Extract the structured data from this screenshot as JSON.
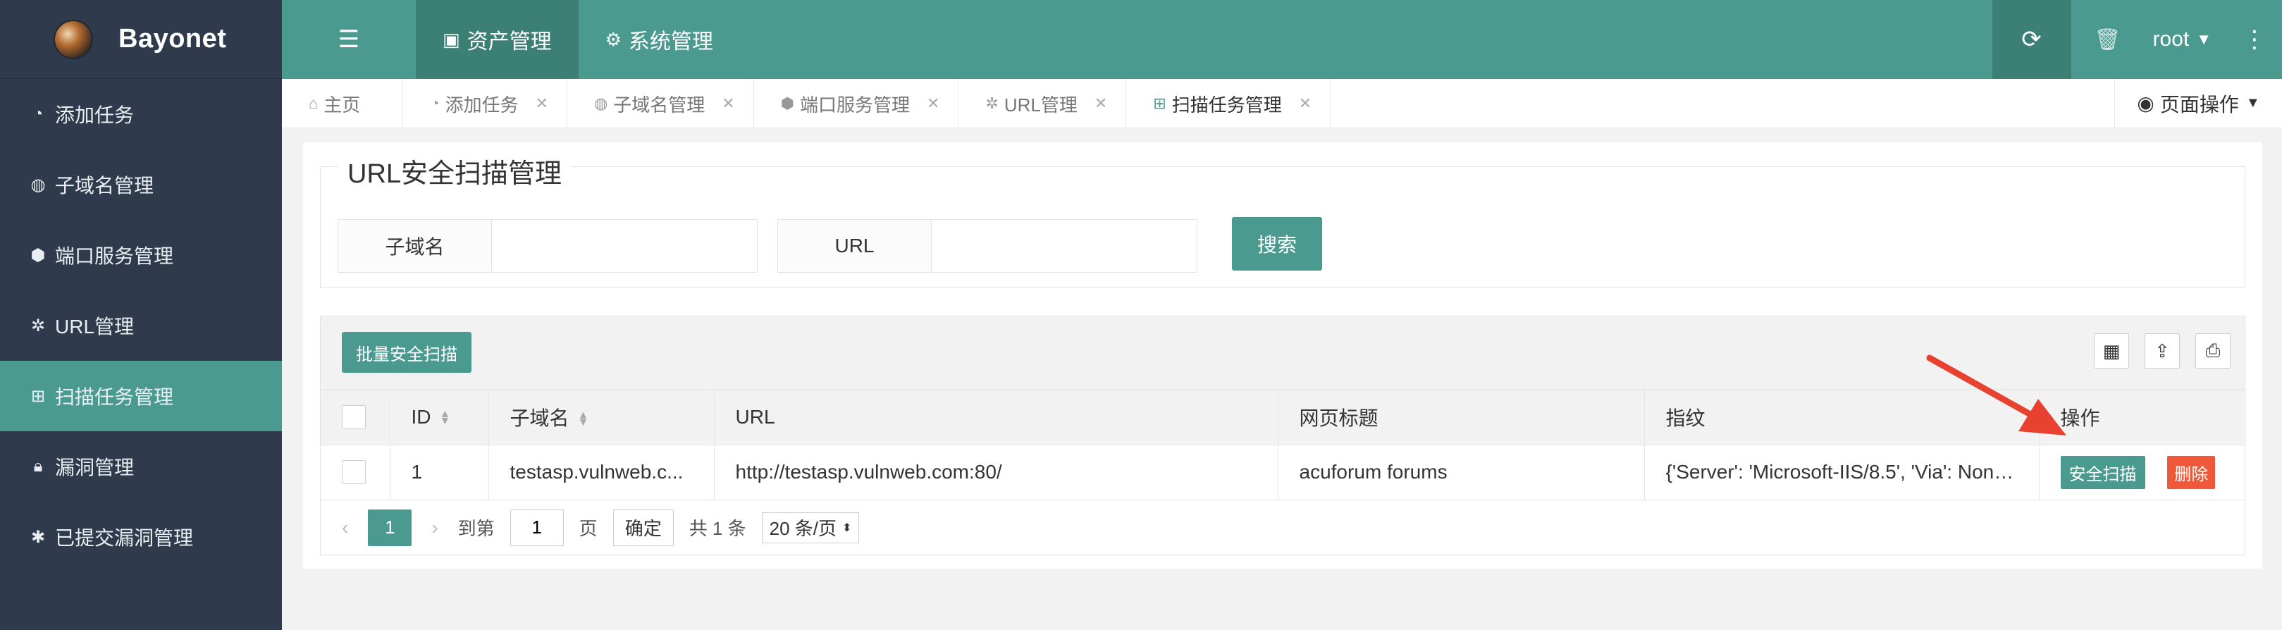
{
  "app": {
    "name": "Bayonet"
  },
  "sidebar": {
    "items": [
      {
        "label": "添加任务",
        "icon": "dashboard-icon"
      },
      {
        "label": "子域名管理",
        "icon": "globe-icon"
      },
      {
        "label": "端口服务管理",
        "icon": "cube-icon"
      },
      {
        "label": "URL管理",
        "icon": "paw-icon"
      },
      {
        "label": "扫描任务管理",
        "icon": "plus-square-icon",
        "active": true
      },
      {
        "label": "漏洞管理",
        "icon": "lock-icon"
      },
      {
        "label": "已提交漏洞管理",
        "icon": "bug-icon"
      }
    ]
  },
  "topbar": {
    "tabs": [
      {
        "label": "资产管理",
        "icon": "address-book-icon",
        "active": true
      },
      {
        "label": "系统管理",
        "icon": "cogs-icon"
      }
    ],
    "user": "root"
  },
  "page_tabs": [
    {
      "label": "主页",
      "icon": "home-icon",
      "closable": false
    },
    {
      "label": "添加任务",
      "icon": "dashboard-icon",
      "closable": true
    },
    {
      "label": "子域名管理",
      "icon": "globe-icon",
      "closable": true
    },
    {
      "label": "端口服务管理",
      "icon": "cube-icon",
      "closable": true
    },
    {
      "label": "URL管理",
      "icon": "paw-icon",
      "closable": true
    },
    {
      "label": "扫描任务管理",
      "icon": "plus-square-icon",
      "closable": true,
      "active": true
    }
  ],
  "page_ops_label": "页面操作",
  "search": {
    "legend": "URL安全扫描管理",
    "subdomain_label": "子域名",
    "subdomain_value": "",
    "url_label": "URL",
    "url_value": "",
    "button": "搜索"
  },
  "table": {
    "batch_button": "批量安全扫描",
    "columns": [
      "ID",
      "子域名",
      "URL",
      "网页标题",
      "指纹",
      "操作"
    ],
    "rows": [
      {
        "id": "1",
        "subdomain": "testasp.vulnweb.c...",
        "url": "http://testasp.vulnweb.com:80/",
        "title": "acuforum forums",
        "fingerprint": "{'Server': 'Microsoft-IIS/8.5', 'Via': None,...",
        "op_scan": "安全扫描",
        "op_delete": "删除"
      }
    ]
  },
  "pager": {
    "current": "1",
    "goto_label": "到第",
    "goto_value": "1",
    "page_unit": "页",
    "confirm": "确定",
    "total": "共 1 条",
    "page_size": "20 条/页"
  },
  "colors": {
    "accent": "#4a9a8f",
    "sidebar": "#2f3b4c",
    "danger": "#f0583a",
    "annotation": "#e8412f"
  }
}
